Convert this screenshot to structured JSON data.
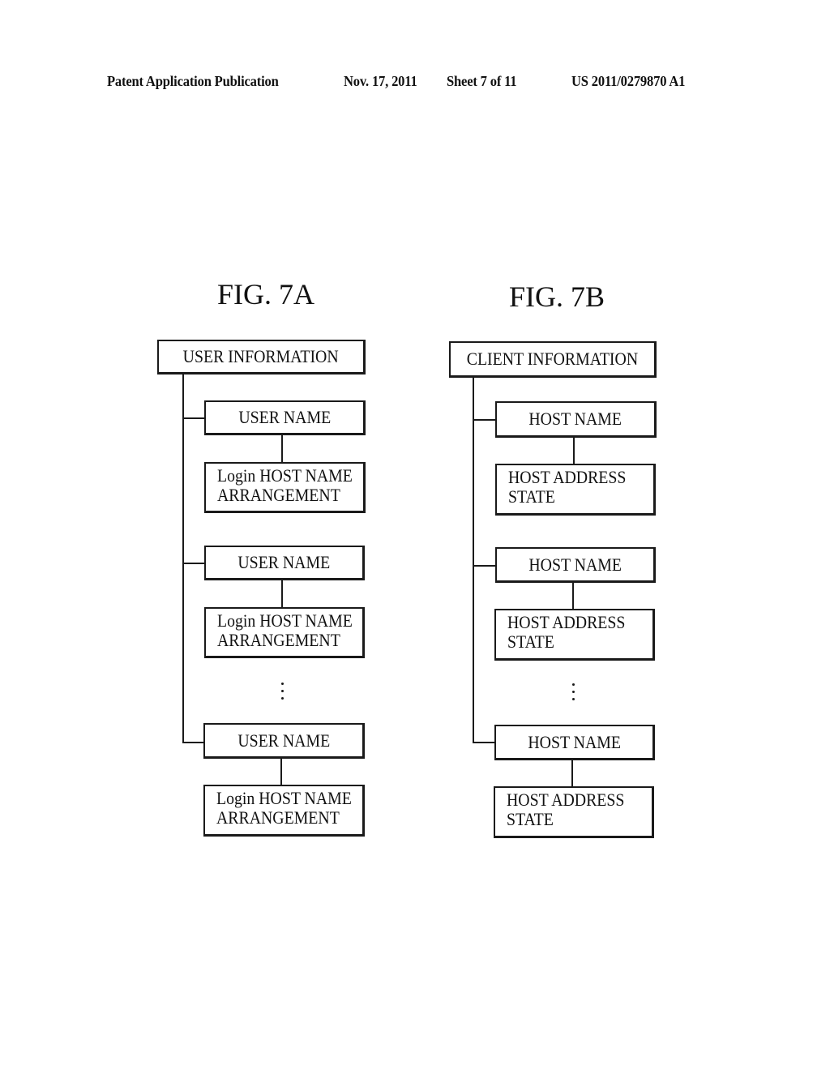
{
  "header": {
    "publication": "Patent Application Publication",
    "date": "Nov. 17, 2011",
    "sheet": "Sheet 7 of 11",
    "number": "US 2011/0279870 A1"
  },
  "fig7a": {
    "title": "FIG. 7A",
    "root": "USER INFORMATION",
    "entries": [
      {
        "name": "USER NAME",
        "detail_line1": "Login HOST NAME",
        "detail_line2": "ARRANGEMENT"
      },
      {
        "name": "USER NAME",
        "detail_line1": "Login HOST NAME",
        "detail_line2": "ARRANGEMENT"
      },
      {
        "name": "USER NAME",
        "detail_line1": "Login HOST NAME",
        "detail_line2": "ARRANGEMENT"
      }
    ],
    "ellipsis": "⋮"
  },
  "fig7b": {
    "title": "FIG. 7B",
    "root": "CLIENT INFORMATION",
    "entries": [
      {
        "name": "HOST NAME",
        "detail_line1": "HOST ADDRESS",
        "detail_line2": "STATE"
      },
      {
        "name": "HOST NAME",
        "detail_line1": "HOST ADDRESS",
        "detail_line2": "STATE"
      },
      {
        "name": "HOST NAME",
        "detail_line1": "HOST ADDRESS",
        "detail_line2": "STATE"
      }
    ],
    "ellipsis": "⋮"
  }
}
